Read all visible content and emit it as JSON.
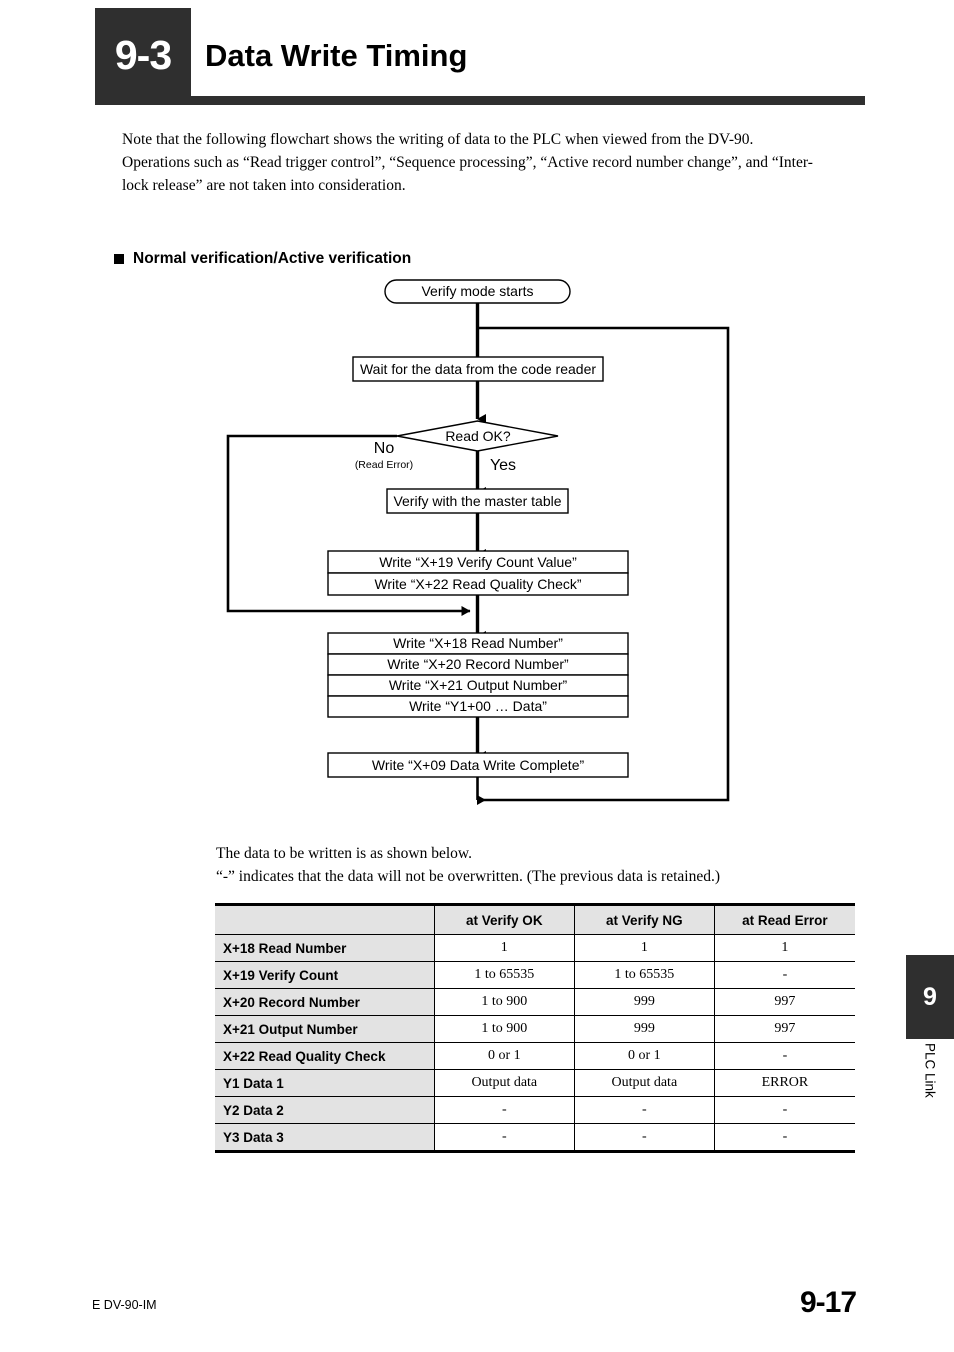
{
  "header": {
    "section_number": "9-3",
    "title": "Data Write Timing"
  },
  "intro": {
    "line1": "Note that the following flowchart shows the writing of data to the PLC when viewed from the DV-90.",
    "line2": "Operations such as “Read trigger control”, “Sequence processing”, “Active record number change”, and “Inter-",
    "line3": "lock release” are not taken into consideration."
  },
  "section": {
    "heading": "Normal verification/Active verification"
  },
  "flowchart": {
    "start_terminator": "Verify mode starts",
    "wait_box": "Wait for the data from the code reader",
    "decision": "Read OK?",
    "branch_no": "No",
    "branch_no_sub": "(Read Error)",
    "branch_yes": "Yes",
    "verify_box": "Verify with the master table",
    "write_group_1": [
      "Write “X+19 Verify Count Value”",
      "Write “X+22 Read Quality Check”"
    ],
    "write_group_2": [
      "Write “X+18 Read Number”",
      "Write “X+20 Record Number”",
      "Write “X+21 Output Number”",
      "Write “Y1+00 … Data”"
    ],
    "complete_box": "Write “X+09 Data Write Complete”"
  },
  "table_note": {
    "line1": "The data to be written is as shown below.",
    "line2": "“-” indicates that the data will not be overwritten. (The previous data is retained.)"
  },
  "table": {
    "corner": "",
    "columns": [
      "at Verify OK",
      "at Verify NG",
      "at Read Error"
    ],
    "rows": [
      {
        "label": "X+18 Read Number",
        "values": [
          "1",
          "1",
          "1"
        ]
      },
      {
        "label": "X+19 Verify Count",
        "values": [
          "1 to 65535",
          "1 to 65535",
          "-"
        ]
      },
      {
        "label": "X+20 Record Number",
        "values": [
          "1 to 900",
          "999",
          "997"
        ]
      },
      {
        "label": "X+21 Output Number",
        "values": [
          "1 to 900",
          "999",
          "997"
        ]
      },
      {
        "label": "X+22 Read Quality Check",
        "values": [
          "0 or 1",
          "0 or 1",
          "-"
        ]
      },
      {
        "label": "Y1 Data 1",
        "values": [
          "Output data",
          "Output data",
          "ERROR"
        ]
      },
      {
        "label": "Y2 Data 2",
        "values": [
          "-",
          "-",
          "-"
        ]
      },
      {
        "label": "Y3 Data 3",
        "values": [
          "-",
          "-",
          "-"
        ]
      }
    ]
  },
  "side_tab": {
    "number": "9",
    "label": "PLC Link"
  },
  "footer": {
    "doc_id": "E DV-90-IM",
    "page_number": "9-17"
  },
  "colors": {
    "dark": "#2f2f2f",
    "header_fill": "#e3e3e3",
    "ink": "#000000",
    "paper": "#ffffff"
  }
}
